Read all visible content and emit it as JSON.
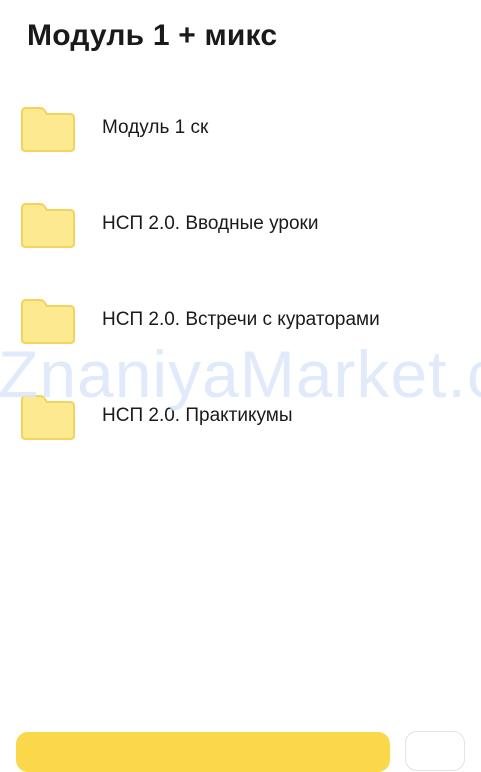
{
  "header": {
    "title": "Модуль 1 + микс"
  },
  "folders": [
    {
      "label": "Модуль 1 ск"
    },
    {
      "label": "НСП 2.0. Вводные уроки"
    },
    {
      "label": "НСП 2.0. Встречи с кураторами"
    },
    {
      "label": "НСП 2.0. Практикумы"
    }
  ],
  "watermark": "ZnaniyaMarket.c",
  "icons": {
    "folder": "folder-icon"
  },
  "colors": {
    "folder_fill": "#fde98f",
    "folder_stroke": "#f3d35e",
    "accent": "#fbd84a"
  }
}
